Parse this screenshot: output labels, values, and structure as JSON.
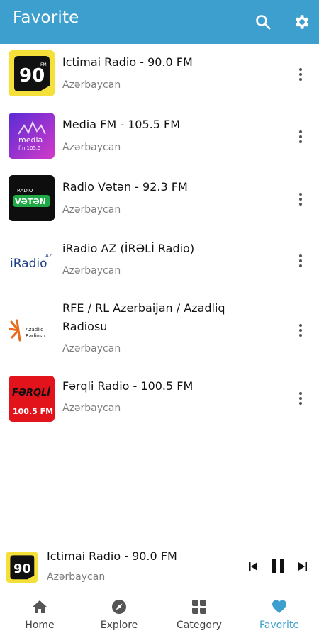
{
  "header": {
    "title": "Favorite",
    "search_icon": "search-icon",
    "settings_icon": "gear-icon",
    "accent": "#3d9fcd"
  },
  "stations": [
    {
      "name": "Ictimai Radio - 90.0 FM",
      "country": "Azərbaycan",
      "logo_text": "90",
      "logo_sub": "FM"
    },
    {
      "name": "Media FM - 105.5 FM",
      "country": "Azərbaycan",
      "logo_text": "media",
      "logo_sub": "fm 105.5"
    },
    {
      "name": "Radio Vətən - 92.3 FM",
      "country": "Azərbaycan",
      "logo_text": "VƏTƏN",
      "logo_sub": "RADIO"
    },
    {
      "name": "iRadio AZ (İRƏLİ Radio)",
      "country": "Azərbaycan",
      "logo_text": "iRadio",
      "logo_sub": "AZ"
    },
    {
      "name": "RFE / RL Azerbaijan / Azadliq Radiosu",
      "country": "Azərbaycan",
      "logo_text": "Azadlıq",
      "logo_sub": "Radiosu"
    },
    {
      "name": "Fərqli Radio - 100.5 FM",
      "country": "Azərbaycan",
      "logo_text": "FƏRQLİ",
      "logo_sub": "100.5 FM"
    }
  ],
  "player": {
    "name": "Ictimai Radio - 90.0 FM",
    "country": "Azərbaycan",
    "logo_text": "90"
  },
  "nav": {
    "items": [
      {
        "label": "Home",
        "icon": "home-icon"
      },
      {
        "label": "Explore",
        "icon": "compass-icon"
      },
      {
        "label": "Category",
        "icon": "grid-icon"
      },
      {
        "label": "Favorite",
        "icon": "heart-icon"
      }
    ],
    "active": "Favorite"
  }
}
